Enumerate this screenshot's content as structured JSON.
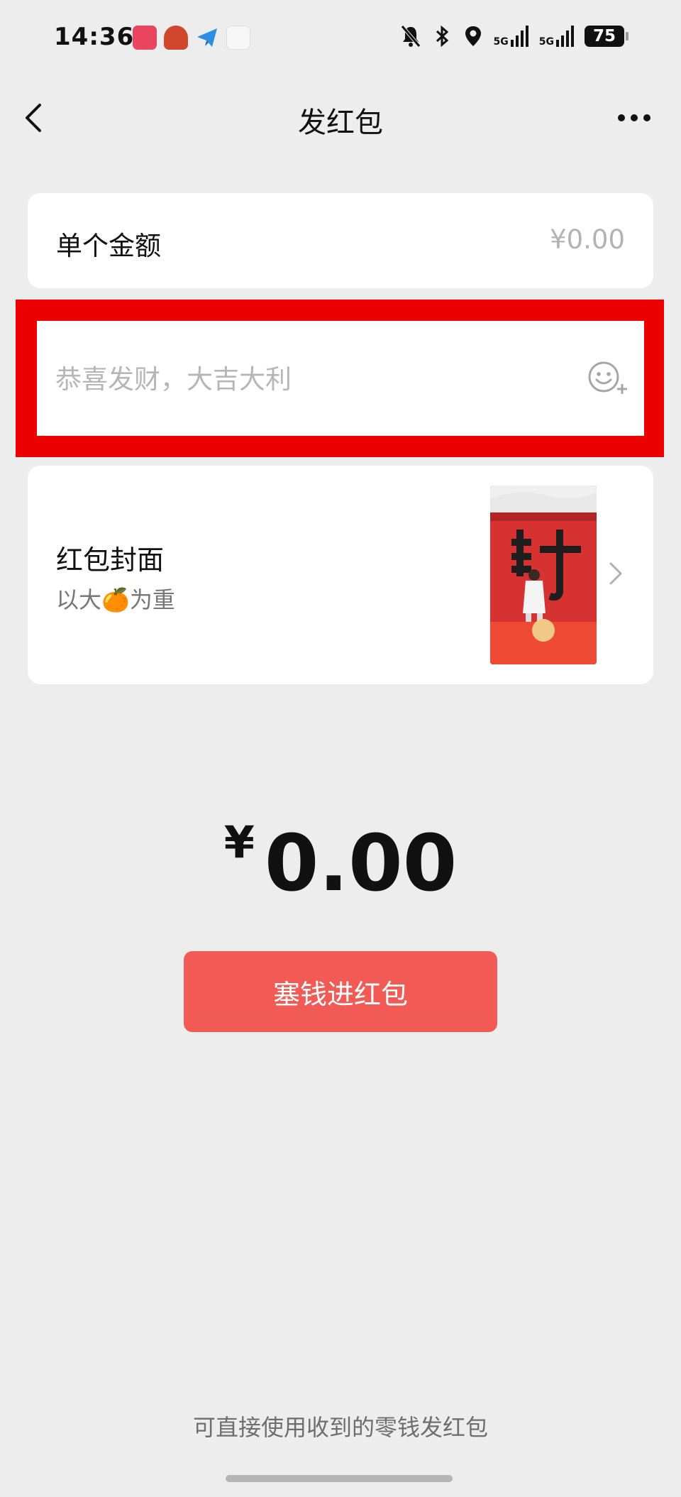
{
  "status_bar": {
    "time": "14:36",
    "network_1": "5G",
    "network_2": "5G",
    "battery": "75"
  },
  "nav": {
    "title": "发红包"
  },
  "amount_row": {
    "label": "单个金额",
    "value": "¥0.00"
  },
  "greeting": {
    "placeholder": "恭喜发财，大吉大利",
    "value": ""
  },
  "cover": {
    "title": "红包封面",
    "subtitle": "以大🍊为重"
  },
  "total": {
    "currency": "¥",
    "value": "0.00"
  },
  "submit_label": "塞钱进红包",
  "footer_tip": "可直接使用收到的零钱发红包",
  "colors": {
    "accent": "#f25a55",
    "highlight": "#ee0000",
    "background": "#ededed"
  }
}
